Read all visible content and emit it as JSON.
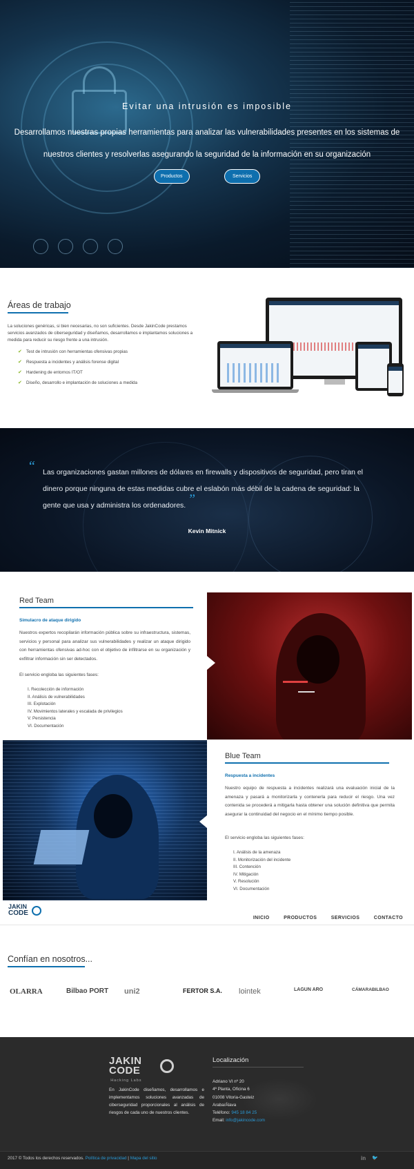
{
  "hero": {
    "title": "Evitar una intrusión es imposible",
    "subtitle": "Desarrollamos nuestras propias herramientas para analizar las vulnerabilidades presentes en los sistemas de nuestros clientes y resolverlas asegurando la seguridad de la información en su organización",
    "buttons": [
      "Productos",
      "Servicios"
    ]
  },
  "areas": {
    "title": "Áreas de trabajo",
    "intro": "La soluciones genéricas, si bien necesarias, no son suficientes. Desde JakinCode prestamos servicios avanzados de ciberseguridad y diseñamos, desarrollamos e implantamos soluciones a medida para reducir su riesgo frente a una intrusión.",
    "items": [
      "Test de intrusión con herramientas ofensivas propias",
      "Respuesta a incidentes y análisis forense digital",
      "Hardening de entornos IT/OT",
      "Diseño, desarrollo e implantación de soluciones a medida"
    ]
  },
  "quote": {
    "text": "Las organizaciones gastan millones de dólares en firewalls y dispositivos de seguridad, pero tiran el dinero porque ninguna de estas medidas cubre el eslabón más débil de la cadena de seguridad: la gente que usa y administra los ordenadores.",
    "open_mark": "“",
    "close_mark": "”",
    "author": "Kevin Mitnick"
  },
  "red_team": {
    "title": "Red Team",
    "kicker": "Simulacro de ataque dirigido",
    "description": "Nuestros expertos recopilarán información pública sobre su infraestructura, sistemas, servicios y personal para analizar sus vulnerabilidades y realizar un ataque dirigido con herramientas ofensivas ad-hoc con el objetivo de infiltrarse en su organización y exfiltrar información sin ser detectados.",
    "phases_intro": "El servicio engloba las siguientes fases:",
    "phases": [
      "I. Recolección de información",
      "II. Análisis de vulnerabilidades",
      "III. Explotación",
      "IV. Movimientos laterales y escalada de privilegios",
      "V. Persistencia",
      "VI. Documentación"
    ]
  },
  "blue_team": {
    "title": "Blue Team",
    "kicker": "Respuesta a incidentes",
    "description": "Nuestro equipo de respuesta a incidentes realizará una evaluación inicial de la amenaza y pasará a monitorizarla y contenerla para reducir el riesgo. Una vez contenida se procederá a mitigarla hasta obtener una solución definitiva que permita asegurar la continuidad del negocio en el mínimo tiempo posible.",
    "phases_intro": "El servicio engloba las siguientes fases:",
    "phases": [
      "I. Análisis de la amenaza",
      "II. Monitorización del incidente",
      "III. Contención",
      "IV. Mitigación",
      "V. Resolución",
      "VI. Documentación"
    ]
  },
  "nav": {
    "logo_line1": "JAKIN",
    "logo_line2": "CODE",
    "menu": [
      "INICIO",
      "PRODUCTOS",
      "SERVICIOS",
      "CONTACTO"
    ]
  },
  "clients": {
    "title": "Confían en nosotros...",
    "logos": [
      "OLARRA",
      "Bilbao PORT",
      "uni2",
      "FERTOR S.A.",
      "lointek",
      "LAGUN ARO",
      "CÁMARABILBAO"
    ]
  },
  "footer": {
    "logo_line1": "JAKIN",
    "logo_line2": "CODE",
    "logo_tag": "Hacking Labs",
    "description": "En JakinCode diseñamos, desarrollamos e implementamos soluciones avanzadas de ciberseguridad proporcionales al análisis de riesgos de cada uno de nuestros clientes.",
    "location_title": "Localización",
    "address": [
      "Adriano VI nº 20",
      "4ª Planta, Oficina 6",
      "01008 Vitoria-Gasteiz",
      "Araba/Álava"
    ],
    "phone_label": "Teléfono:",
    "phone": "945 18 84 25",
    "email_label": "Email:",
    "email": "info@jakincode.com",
    "copyright": "2017 © Todos los derechos reservados.",
    "privacy": "Política de privacidad",
    "separator": "|",
    "sitemap": "Mapa del sitio",
    "social": [
      "in",
      "🐦"
    ]
  },
  "colors": {
    "accent": "#0e6fae",
    "link": "#2a9ad6",
    "check": "#8cb82c",
    "footer_bg": "#2b2b2b"
  }
}
